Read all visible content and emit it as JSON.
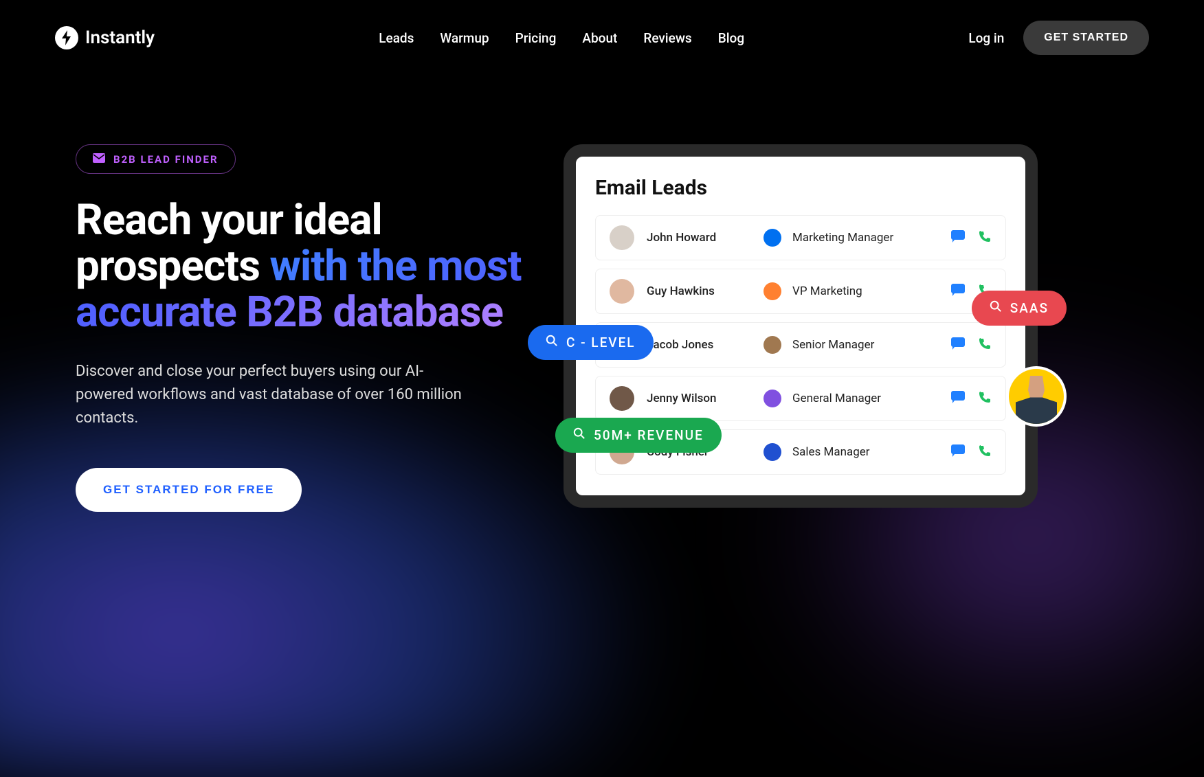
{
  "brand": "Instantly",
  "nav": {
    "items": [
      "Leads",
      "Warmup",
      "Pricing",
      "About",
      "Reviews",
      "Blog"
    ]
  },
  "header": {
    "login": "Log in",
    "get_started": "GET STARTED"
  },
  "hero": {
    "badge": "B2B LEAD FINDER",
    "headline_white": "Reach your ideal prospects ",
    "headline_gradient": "with the most accurate B2B database",
    "subtext": "Discover and close your perfect buyers using our AI-powered workflows and vast database of over 160 million contacts.",
    "cta": "GET STARTED FOR FREE"
  },
  "card": {
    "title": "Email Leads",
    "leads": [
      {
        "name": "John Howard",
        "title": "Marketing Manager",
        "avatar_bg": "#d8d0c8",
        "company_bg": "#0070f0"
      },
      {
        "name": "Guy Hawkins",
        "title": "VP Marketing",
        "avatar_bg": "#e0b8a0",
        "company_bg": "#ff8030"
      },
      {
        "name": "Jacob Jones",
        "title": "Senior Manager",
        "avatar_bg": "#806050",
        "company_bg": "#a07850"
      },
      {
        "name": "Jenny Wilson",
        "title": "General Manager",
        "avatar_bg": "#705848",
        "company_bg": "#8050e0"
      },
      {
        "name": "Cody Fisher",
        "title": "Sales Manager",
        "avatar_bg": "#d0a890",
        "company_bg": "#2050d0"
      }
    ]
  },
  "pills": {
    "blue": "C - LEVEL",
    "green": "50M+ REVENUE",
    "red": "SAAS"
  }
}
